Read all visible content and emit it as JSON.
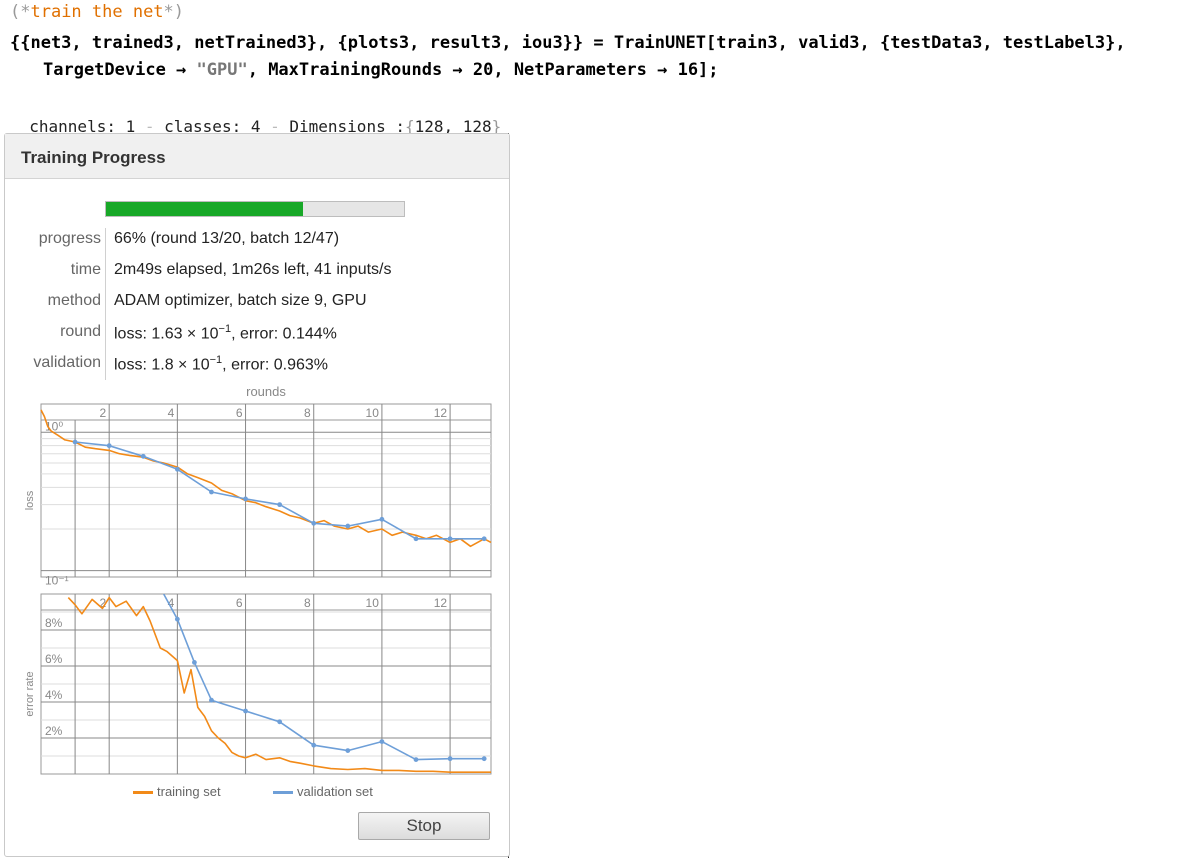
{
  "code": {
    "comment": "train the net",
    "line1": "{{net3, trained3, netTrained3}, {plots3, result3, iou3}} = TrainUNET[train3, valid3, {testData3, testLabel3},",
    "line2_a": "TargetDevice → ",
    "line2_str": "\"GPU\"",
    "line2_b": ", MaxTrainingRounds → 20, NetParameters → 16];"
  },
  "output": {
    "channels_label": "channels: 1",
    "classes_label": "classes: 4",
    "dims_label": "Dimensions :",
    "dims_value": "128, 128"
  },
  "panel": {
    "title": "Training Progress",
    "progress_fraction": 0.66,
    "rows": [
      {
        "key": "progress",
        "value": "66% (round 13/20, batch 12/47)"
      },
      {
        "key": "time",
        "value": "2m49s elapsed, 1m26s left, 41 inputs/s"
      },
      {
        "key": "method",
        "value": "ADAM optimizer, batch size 9, GPU"
      },
      {
        "key": "round",
        "value_prefix": "loss: 1.63 × 10",
        "value_exp": "−1",
        "value_suffix": ", error: 0.144%"
      },
      {
        "key": "validation",
        "value_prefix": "loss: 1.8 × 10",
        "value_exp": "−1",
        "value_suffix": ", error: 0.963%"
      }
    ],
    "stop_label": "Stop"
  },
  "colors": {
    "training": "#f28a18",
    "validation": "#6e9fd8",
    "progress_fill": "#18a828"
  },
  "chart_data": [
    {
      "type": "line",
      "xlabel": "rounds",
      "ylabel": "loss",
      "scale": "log",
      "xlim": [
        0,
        13.2
      ],
      "ylim": [
        0.09,
        1.6
      ],
      "x_ticks": [
        2,
        4,
        6,
        8,
        10,
        12
      ],
      "y_ticks": [
        "10⁰",
        "10⁻¹"
      ],
      "series": [
        {
          "name": "training set",
          "x": [
            0,
            0.1,
            0.2,
            0.3,
            0.5,
            0.7,
            1,
            1.3,
            1.6,
            2,
            2.3,
            2.6,
            3,
            3.3,
            3.6,
            4,
            4.3,
            4.6,
            5,
            5.3,
            5.6,
            6,
            6.3,
            6.6,
            7,
            7.3,
            7.6,
            8,
            8.3,
            8.6,
            9,
            9.3,
            9.6,
            10,
            10.3,
            10.6,
            11,
            11.3,
            11.6,
            12,
            12.3,
            12.6,
            13,
            13.2
          ],
          "y": [
            1.45,
            1.3,
            1.1,
            1.02,
            0.95,
            0.88,
            0.85,
            0.78,
            0.76,
            0.74,
            0.7,
            0.68,
            0.66,
            0.62,
            0.6,
            0.56,
            0.5,
            0.47,
            0.43,
            0.38,
            0.36,
            0.32,
            0.31,
            0.29,
            0.27,
            0.25,
            0.24,
            0.22,
            0.23,
            0.21,
            0.2,
            0.21,
            0.19,
            0.2,
            0.18,
            0.19,
            0.18,
            0.17,
            0.18,
            0.16,
            0.17,
            0.15,
            0.17,
            0.16
          ]
        },
        {
          "name": "validation set",
          "x": [
            1,
            2,
            3,
            4,
            5,
            6,
            7,
            8,
            9,
            10,
            11,
            12,
            13
          ],
          "y": [
            0.85,
            0.8,
            0.67,
            0.54,
            0.37,
            0.33,
            0.3,
            0.22,
            0.21,
            0.235,
            0.17,
            0.17,
            0.17
          ]
        }
      ]
    },
    {
      "type": "line",
      "xlabel": "",
      "ylabel": "error rate",
      "xlim": [
        0,
        13.2
      ],
      "ylim": [
        0,
        10
      ],
      "x_ticks": [
        2,
        4,
        6,
        8,
        10,
        12
      ],
      "y_ticks": [
        "2%",
        "4%",
        "6%",
        "8%"
      ],
      "y_tick_values": [
        2,
        4,
        6,
        8
      ],
      "series": [
        {
          "name": "training set",
          "x": [
            0.8,
            1,
            1.2,
            1.5,
            1.8,
            2,
            2.2,
            2.5,
            2.8,
            3,
            3.2,
            3.5,
            3.7,
            4,
            4.2,
            4.4,
            4.6,
            4.8,
            5,
            5.2,
            5.4,
            5.6,
            5.8,
            6,
            6.3,
            6.6,
            7,
            7.3,
            7.6,
            8,
            8.5,
            9,
            9.5,
            10,
            10.5,
            11,
            11.5,
            12,
            12.5,
            13,
            13.2
          ],
          "y": [
            9.8,
            9.4,
            8.9,
            9.7,
            9.2,
            9.8,
            9.3,
            9.6,
            8.8,
            9.3,
            8.5,
            7.0,
            6.8,
            6.3,
            4.5,
            5.8,
            3.7,
            3.2,
            2.4,
            2.0,
            1.7,
            1.2,
            1.0,
            0.9,
            1.1,
            0.8,
            0.9,
            0.7,
            0.6,
            0.45,
            0.3,
            0.25,
            0.3,
            0.2,
            0.2,
            0.15,
            0.15,
            0.1,
            0.1,
            0.1,
            0.1
          ]
        },
        {
          "name": "validation set",
          "x": [
            3.6,
            4,
            4.5,
            5,
            6,
            7,
            8,
            9,
            10,
            11,
            12,
            13
          ],
          "y": [
            10,
            8.6,
            6.2,
            4.1,
            3.5,
            2.9,
            1.6,
            1.3,
            1.8,
            0.8,
            0.85,
            0.85
          ]
        }
      ]
    }
  ]
}
